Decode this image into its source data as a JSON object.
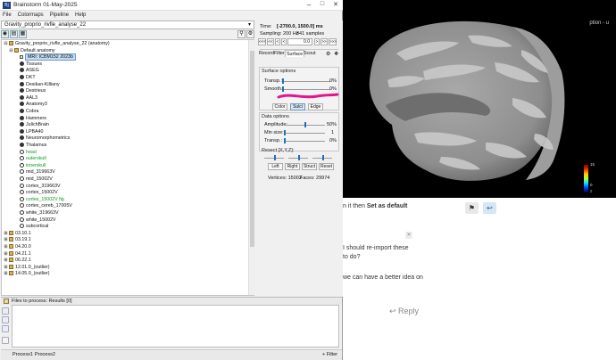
{
  "window": {
    "title": "Brainstorm 01-May-2025",
    "min_glyph": "–",
    "max_glyph": "□",
    "close_glyph": "✕"
  },
  "menu": [
    "File",
    "Colormaps",
    "Pipeline",
    "Help"
  ],
  "protocol_combo": {
    "value": "Gravity_proprio_rivfle_analyse_22"
  },
  "toolbar_icons": [
    "subject-view-icon",
    "study-view-icon",
    "condition-view-icon"
  ],
  "tree": {
    "root": "Gravity_proprio_rivfle_analyse_22 (anatomy)",
    "default_anatomy": "Default anatomy",
    "mri": "MRI: ICBM152 2023b",
    "items": [
      {
        "label": "Tissues",
        "icon": "solid",
        "green": false
      },
      {
        "label": "ASEG",
        "icon": "solid",
        "green": false
      },
      {
        "label": "DKT",
        "icon": "solid",
        "green": false
      },
      {
        "label": "Desikan-Killiany",
        "icon": "solid",
        "green": false
      },
      {
        "label": "Destrieux",
        "icon": "solid",
        "green": false
      },
      {
        "label": "AAL3",
        "icon": "solid",
        "green": false
      },
      {
        "label": "Anatomy3",
        "icon": "solid",
        "green": false
      },
      {
        "label": "Cobra",
        "icon": "solid",
        "green": false
      },
      {
        "label": "Hammers",
        "icon": "solid",
        "green": false
      },
      {
        "label": "JulichBrain",
        "icon": "solid",
        "green": false
      },
      {
        "label": "LPBA40",
        "icon": "solid",
        "green": false
      },
      {
        "label": "Neuromorphometrics",
        "icon": "solid",
        "green": false
      },
      {
        "label": "Thalamus",
        "icon": "solid",
        "green": false
      },
      {
        "label": "head",
        "icon": "ring",
        "green": true
      },
      {
        "label": "outerskull",
        "icon": "ring",
        "green": true
      },
      {
        "label": "innerskull",
        "icon": "ring",
        "green": true
      },
      {
        "label": "mid_319663V",
        "icon": "ring",
        "green": false
      },
      {
        "label": "mid_15002V",
        "icon": "ring",
        "green": false
      },
      {
        "label": "cortex_319663V",
        "icon": "ring",
        "green": false
      },
      {
        "label": "cortex_15002V",
        "icon": "ring",
        "green": false
      },
      {
        "label": "cortex_15002V fig",
        "icon": "ring",
        "green": true
      },
      {
        "label": "cortex_cereb_17005V",
        "icon": "ring",
        "green": false
      },
      {
        "label": "white_319663V",
        "icon": "ring",
        "green": false
      },
      {
        "label": "white_15002V",
        "icon": "ring",
        "green": false
      },
      {
        "label": "subcortical",
        "icon": "ring",
        "green": false
      }
    ],
    "subjects": [
      "03.10.1",
      "03.19.1",
      "04.20.0",
      "04.21.1",
      "06.22.1",
      "12.01.0_(outlier)",
      "14.05.0_(outlier)"
    ]
  },
  "process": {
    "header": "Files to process: Results [0]",
    "tab1": "Process1",
    "tab2": "Process2",
    "filter": "+ Filter"
  },
  "panel": {
    "time_label": "Time:",
    "time_value": "[-2700.0, 1500.0] ms",
    "sampling": "Sampling: 200 Hz",
    "samples": "841 samples",
    "time_field": "0.0",
    "nav_buttons": [
      "<<<",
      "<<",
      "<",
      "<",
      ">",
      ">>",
      ">>>"
    ],
    "tabs": [
      "Record",
      "Filter",
      "Surface",
      "Scout"
    ],
    "surface_options": "Surface options",
    "transp_label": "Transp.:",
    "transp_value": "0%",
    "smooth_label": "Smooth.:",
    "smooth_value": "0%",
    "color_btn": "Color",
    "sulci_btn": "Sulci",
    "edge_btn": "Edge",
    "data_options": "Data options",
    "amplitude_label": "Amplitude:",
    "amplitude_value": "50%",
    "minsize_label": "Min size:",
    "minsize_value": "1",
    "transp2_label": "Transp.:",
    "transp2_value": "0%",
    "resect_label": "Resect [X,Y,Z]:",
    "resect_buttons": [
      "Left",
      "Right",
      "Struct",
      "Reset"
    ],
    "vertices": "Vertices: 15002",
    "faces": "Faces: 29974"
  },
  "colorbar": {
    "max": "15",
    "min": "0",
    "z": "z",
    "colors": [
      "#7a0000",
      "#ff2a00",
      "#ffcc00",
      "#b0ff40",
      "#00e0ff",
      "#0040ff",
      "#00005a"
    ]
  },
  "forum": {
    "text1_prefix": "n it then ",
    "text1_bold": "Set as default",
    "text2": "I should re-import these",
    "text3": "to do?",
    "text4": "we can have a better idea on",
    "reply": "Reply",
    "fragment_top": "ption - u"
  },
  "accent": "#e3168c"
}
